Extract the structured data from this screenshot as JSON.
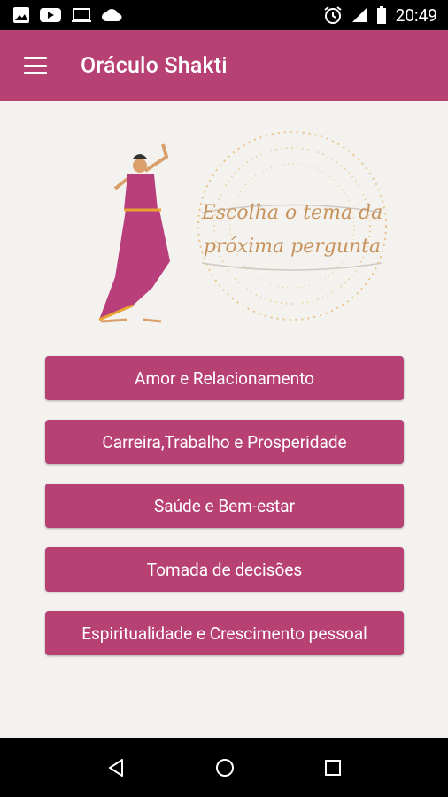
{
  "status_bar": {
    "time": "20:49"
  },
  "app_bar": {
    "title": "Oráculo Shakti"
  },
  "hero": {
    "line1": "Escolha o tema da",
    "line2": "próxima pergunta"
  },
  "topics": [
    "Amor e Relacionamento",
    "Carreira,Trabalho e Prosperidade",
    "Saúde e Bem-estar",
    "Tomada de decisões",
    "Espiritualidade e Crescimento pessoal"
  ]
}
